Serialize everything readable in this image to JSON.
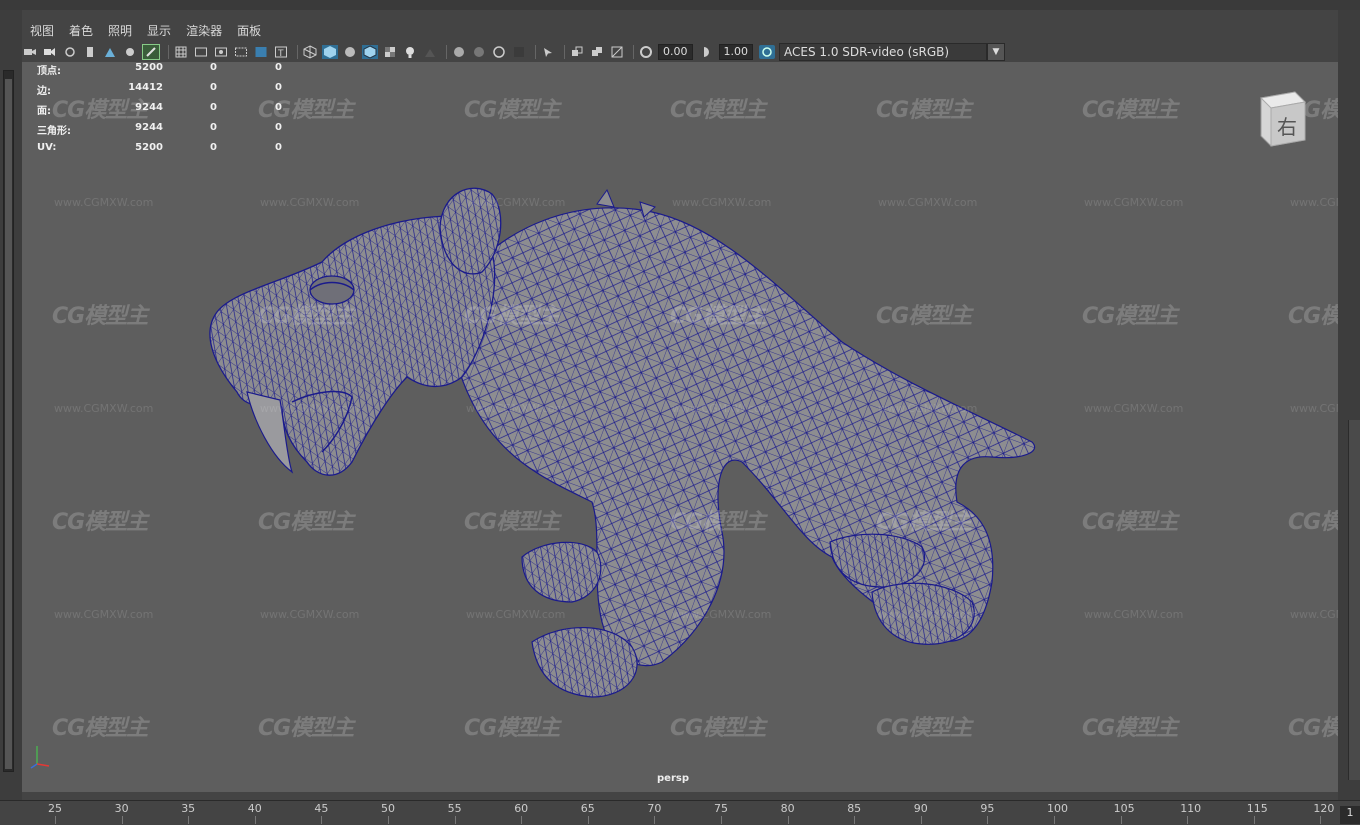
{
  "menu": [
    "视图",
    "着色",
    "照明",
    "显示",
    "渲染器",
    "面板"
  ],
  "toolbar": {
    "exposure_value": "0.00",
    "gamma_value": "1.00",
    "color_space": "ACES 1.0 SDR-video (sRGB)"
  },
  "hud": [
    {
      "label": "顶点:",
      "v1": "5200",
      "v2": "0",
      "v3": "0"
    },
    {
      "label": "边:",
      "v1": "14412",
      "v2": "0",
      "v3": "0"
    },
    {
      "label": "面:",
      "v1": "9244",
      "v2": "0",
      "v3": "0"
    },
    {
      "label": "三角形:",
      "v1": "9244",
      "v2": "0",
      "v3": "0"
    },
    {
      "label": "UV:",
      "v1": "5200",
      "v2": "0",
      "v3": "0"
    }
  ],
  "viewcube_face": "右",
  "camera": "persp",
  "watermark": {
    "logo": "CG模型主",
    "url": "www.CGMXW.com"
  },
  "timeline_ticks": [
    "25",
    "30",
    "35",
    "40",
    "45",
    "50",
    "55",
    "60",
    "65",
    "70",
    "75",
    "80",
    "85",
    "90",
    "95",
    "100",
    "105",
    "110",
    "115",
    "120"
  ],
  "current_frame": "1",
  "colors": {
    "wire": "#1a1a8c",
    "mesh": "#8d8d90",
    "viewport": "#5e5e5e",
    "accent": "#3aa0c8"
  }
}
